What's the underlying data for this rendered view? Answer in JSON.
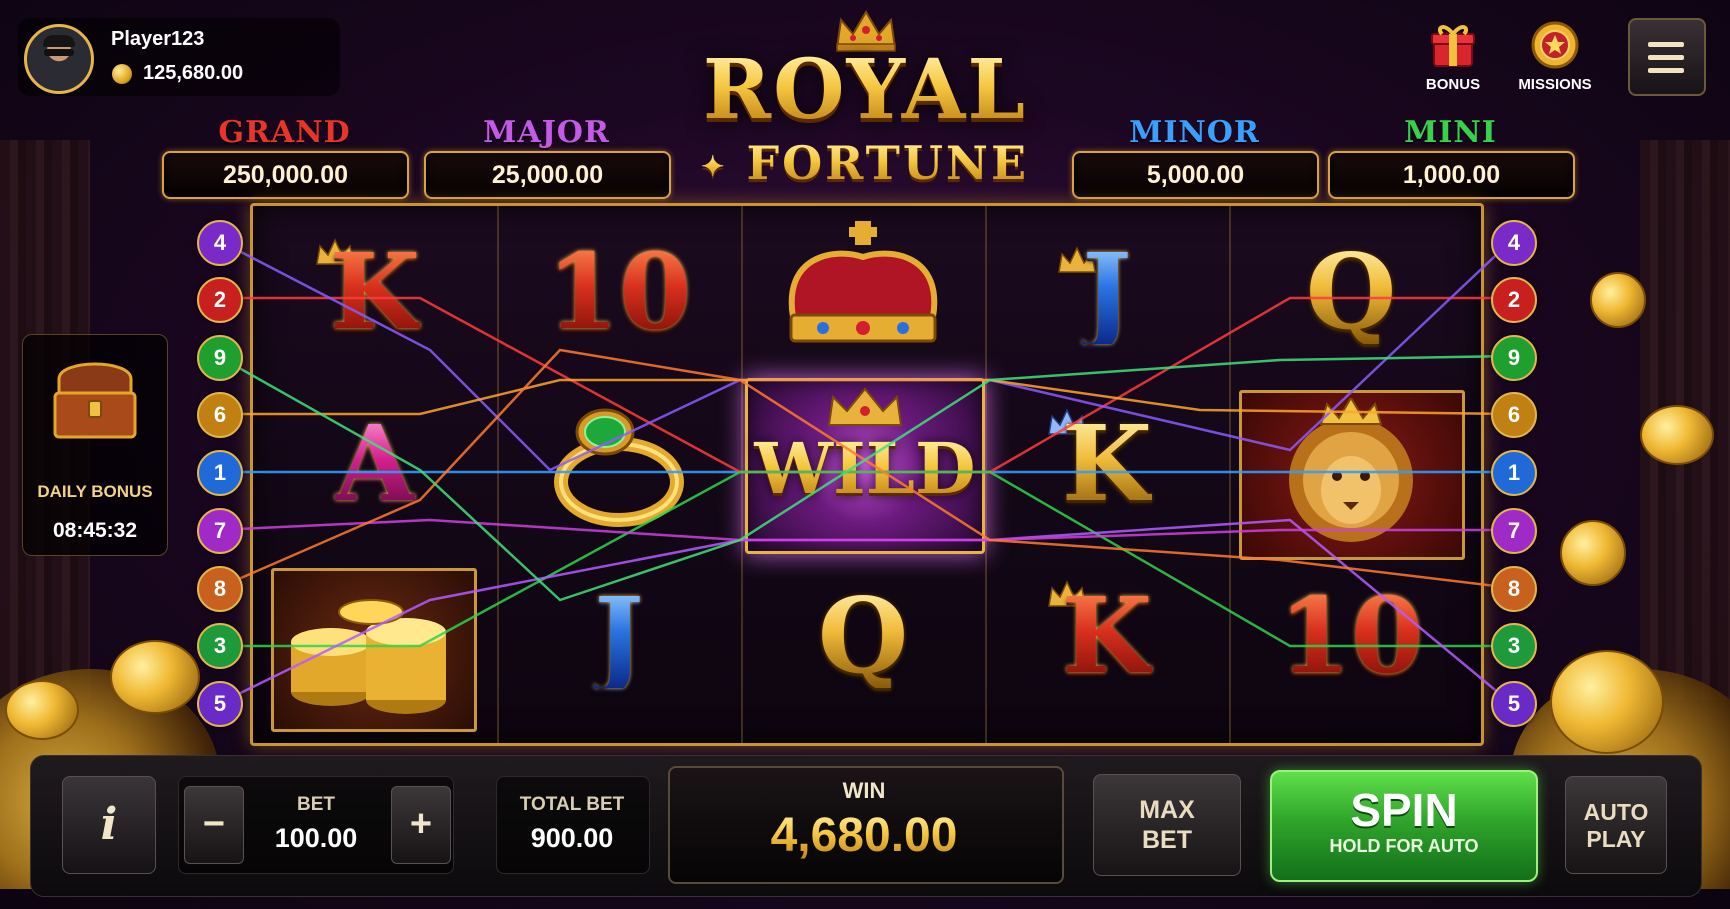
{
  "player": {
    "name": "Player123",
    "balance": "125,680.00"
  },
  "logo": {
    "title": "ROYAL",
    "subtitle": "FORTUNE"
  },
  "top_buttons": [
    {
      "label": "BONUS",
      "icon": "gift-icon"
    },
    {
      "label": "MISSIONS",
      "icon": "star-medal-icon"
    }
  ],
  "jackpots": [
    {
      "label": "GRAND",
      "value": "250,000.00",
      "color": "#e8352a"
    },
    {
      "label": "MAJOR",
      "value": "25,000.00",
      "color": "#c35be6"
    },
    {
      "label": "MINOR",
      "value": "5,000.00",
      "color": "#3aa0ff"
    },
    {
      "label": "MINI",
      "value": "1,000.00",
      "color": "#38d24a"
    }
  ],
  "paylines_left": [
    "4",
    "2",
    "9",
    "6",
    "1",
    "7",
    "8",
    "3",
    "5"
  ],
  "paylines_right": [
    "4",
    "2",
    "9",
    "6",
    "1",
    "7",
    "8",
    "3",
    "5"
  ],
  "reels": [
    [
      "K",
      "A",
      "gold-coins-icon"
    ],
    [
      "10",
      "emerald-ring-icon",
      "J"
    ],
    [
      "royal-crown-icon",
      "WILD",
      "Q"
    ],
    [
      "J",
      "K",
      "K"
    ],
    [
      "Q",
      "lion-icon",
      "10"
    ]
  ],
  "daily_bonus": {
    "label": "DAILY BONUS",
    "timer": "08:45:32"
  },
  "controls": {
    "info": "i",
    "bet_label": "BET",
    "bet_value": "100.00",
    "minus": "−",
    "plus": "+",
    "total_bet_label": "TOTAL BET",
    "total_bet_value": "900.00",
    "win_label": "WIN",
    "win_value": "4,680.00",
    "max_bet": [
      "MAX",
      "BET"
    ],
    "spin_label": "SPIN",
    "spin_sub": "HOLD FOR AUTO",
    "auto_play": [
      "AUTO",
      "PLAY"
    ]
  }
}
